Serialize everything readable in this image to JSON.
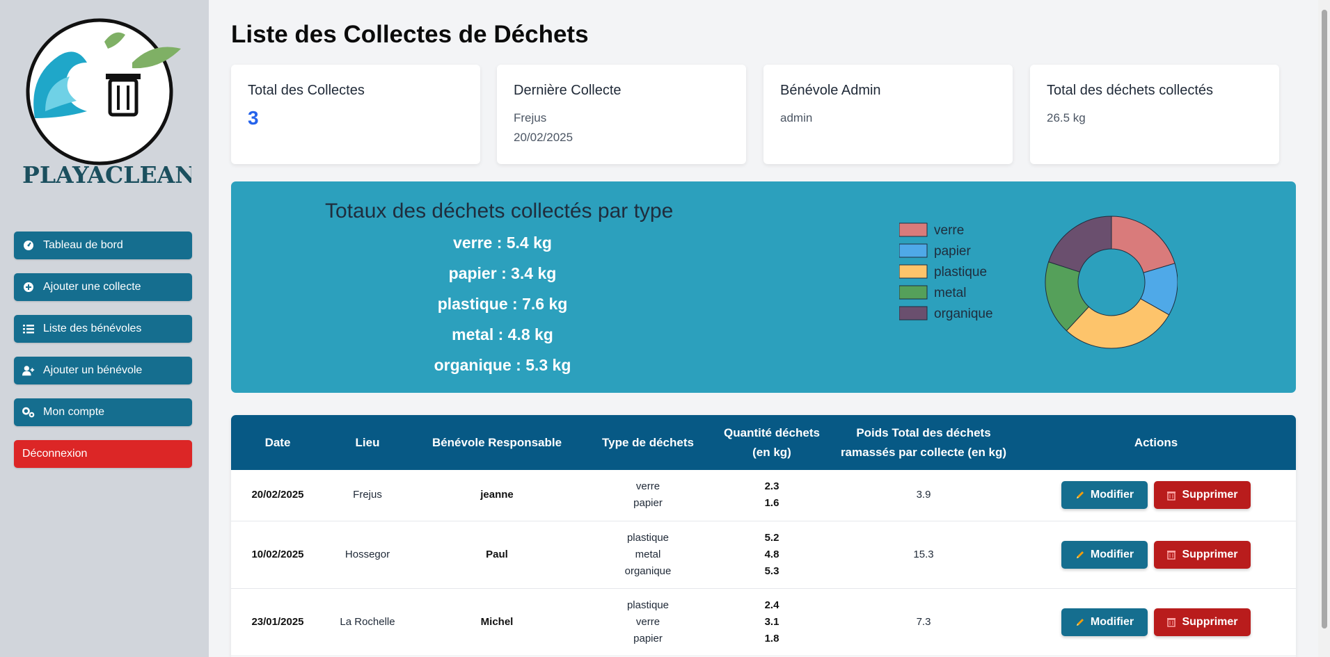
{
  "sidebar": {
    "logo_text": "PLAYACLEAN",
    "items": [
      {
        "label": "Tableau de bord",
        "icon": "dashboard-icon"
      },
      {
        "label": "Ajouter une collecte",
        "icon": "plus-circle-icon"
      },
      {
        "label": "Liste des bénévoles",
        "icon": "list-icon"
      },
      {
        "label": "Ajouter un bénévole",
        "icon": "user-plus-icon"
      },
      {
        "label": "Mon compte",
        "icon": "gears-icon"
      }
    ],
    "logout": "Déconnexion"
  },
  "page_title": "Liste des Collectes de Déchets",
  "cards": {
    "total": {
      "title": "Total des Collectes",
      "value": "3"
    },
    "last": {
      "title": "Dernière Collecte",
      "place": "Frejus",
      "date": "20/02/2025"
    },
    "admin": {
      "title": "Bénévole Admin",
      "value": "admin"
    },
    "weight": {
      "title": "Total des déchets collectés",
      "value": "26.5 kg"
    }
  },
  "summary": {
    "title": "Totaux des déchets collectés par type",
    "lines": [
      "verre : 5.4 kg",
      "papier : 3.4 kg",
      "plastique : 7.6 kg",
      "metal : 4.8 kg",
      "organique : 5.3 kg"
    ]
  },
  "chart_data": {
    "type": "pie",
    "categories": [
      "verre",
      "papier",
      "plastique",
      "metal",
      "organique"
    ],
    "values": [
      5.4,
      3.4,
      7.6,
      4.8,
      5.3
    ],
    "colors": [
      "#d97b7b",
      "#4fa9e8",
      "#fdc46b",
      "#55a05a",
      "#6a4f6e"
    ],
    "legend": "left"
  },
  "table": {
    "headers": [
      "Date",
      "Lieu",
      "Bénévole Responsable",
      "Type de déchets",
      "Quantité déchets (en kg)",
      "Poids Total des déchets ramassés par collecte (en kg)",
      "Actions"
    ],
    "edit_label": "Modifier",
    "delete_label": "Supprimer",
    "rows": [
      {
        "date": "20/02/2025",
        "lieu": "Frejus",
        "benevole": "jeanne",
        "types": [
          "verre",
          "papier"
        ],
        "quantites": [
          "2.3",
          "1.6"
        ],
        "total": "3.9"
      },
      {
        "date": "10/02/2025",
        "lieu": "Hossegor",
        "benevole": "Paul",
        "types": [
          "plastique",
          "metal",
          "organique"
        ],
        "quantites": [
          "5.2",
          "4.8",
          "5.3"
        ],
        "total": "15.3"
      },
      {
        "date": "23/01/2025",
        "lieu": "La Rochelle",
        "benevole": "Michel",
        "types": [
          "plastique",
          "verre",
          "papier"
        ],
        "quantites": [
          "2.4",
          "3.1",
          "1.8"
        ],
        "total": "7.3"
      }
    ]
  }
}
